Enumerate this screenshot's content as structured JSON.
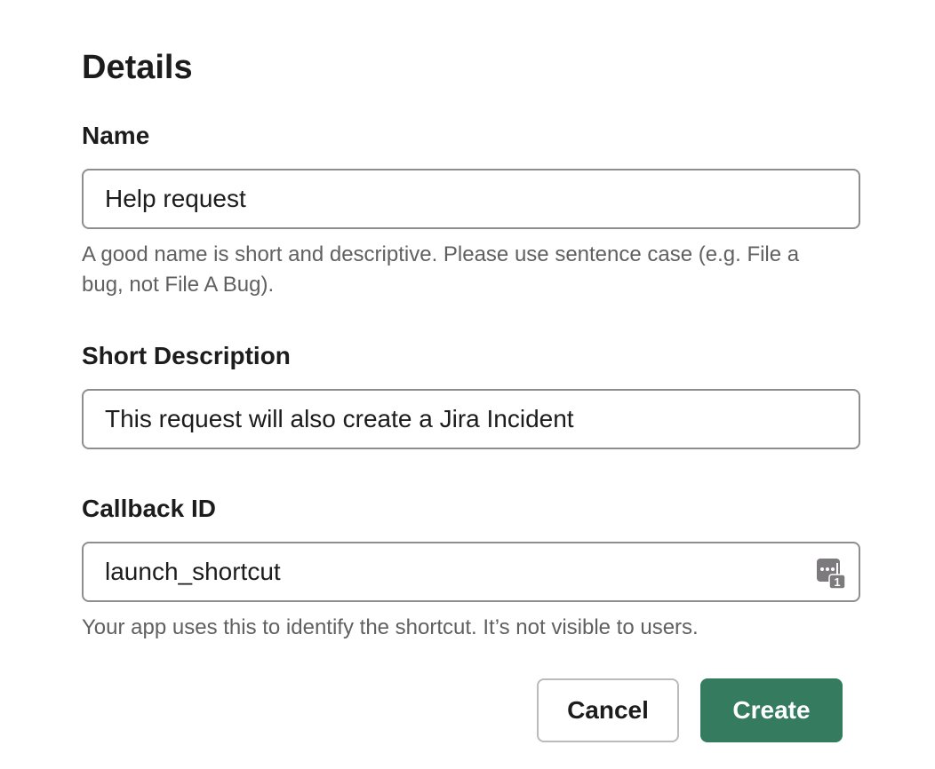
{
  "section": {
    "title": "Details"
  },
  "name_field": {
    "label": "Name",
    "value": "Help request",
    "hint": "A good name is short and descriptive. Please use sentence case (e.g. File a bug, not File A Bug)."
  },
  "description_field": {
    "label": "Short Description",
    "value": "This request will also create a Jira Incident"
  },
  "callback_field": {
    "label": "Callback ID",
    "value": "launch_shortcut",
    "icon": "password-manager-icon",
    "icon_badge": "1",
    "hint": "Your app uses this to identify the shortcut. It’s not visible to users."
  },
  "actions": {
    "cancel_label": "Cancel",
    "create_label": "Create"
  },
  "colors": {
    "primary": "#357b5f",
    "text": "#1d1c1d",
    "hint": "#616061",
    "border": "#8e8d8f"
  }
}
